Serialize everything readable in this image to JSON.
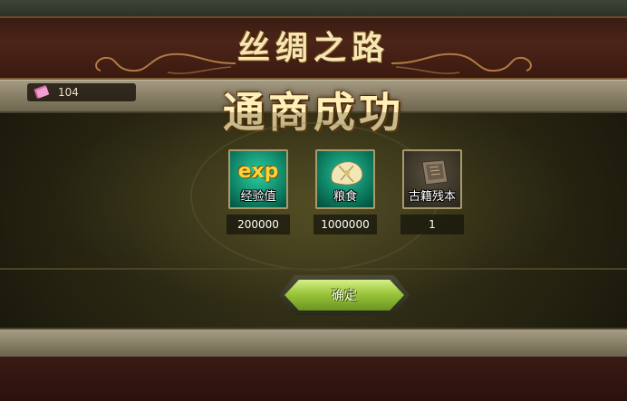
{
  "window": {
    "title": "丝绸之路",
    "success_heading": "通商成功"
  },
  "counter": {
    "icon": "ticket-icon",
    "value": "104"
  },
  "rewards": [
    {
      "icon": "exp-icon",
      "icon_text": "exp",
      "label": "经验值",
      "amount": "200000"
    },
    {
      "icon": "grain-icon",
      "label": "粮食",
      "amount": "1000000"
    },
    {
      "icon": "ancient-book-icon",
      "label": "古籍残本",
      "amount": "1"
    }
  ],
  "confirm_button": {
    "label": "确定"
  },
  "colors": {
    "title_gold": "#f6e6b4",
    "button_green": "#9cc63c",
    "banner_red": "#4c2418"
  }
}
